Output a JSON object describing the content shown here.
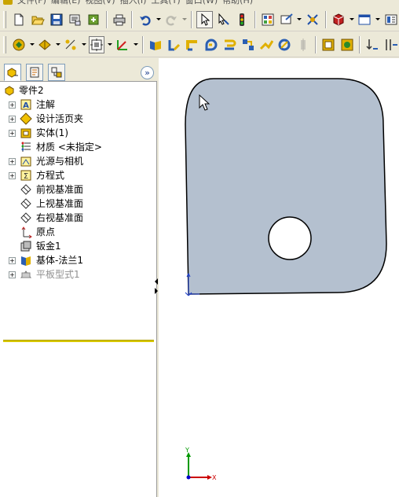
{
  "menu": {
    "items": [
      "文件(F)",
      "编辑(E)",
      "视图(V)",
      "插入(I)",
      "工具(T)",
      "窗口(W)",
      "帮助(H)"
    ]
  },
  "toolbar1": {
    "buttons": [
      "new-document",
      "open",
      "save",
      "print-preview",
      "rebuild",
      "print",
      "undo",
      "redo",
      "select",
      "smart-select",
      "traffic-light",
      "options",
      "edit-appearance",
      "cube",
      "window",
      "task-pane"
    ]
  },
  "toolbar2": {
    "buttons": [
      "view-orientation",
      "display-style",
      "hide-show",
      "section-view",
      "view-settings",
      "sheet-metal-bend",
      "base-flange",
      "edge-flange",
      "miter-flange",
      "hem",
      "jog",
      "sketched-bend",
      "cross-break",
      "flatten",
      "unfold",
      "fold",
      "insert-bends"
    ]
  },
  "feature_tree": {
    "tabs": [
      "featuremanager-tab",
      "propertymanager-tab",
      "configurationmanager-tab"
    ],
    "collapse_label": "»",
    "root": "零件2",
    "items": [
      {
        "label": "注解",
        "icon": "annotations-icon",
        "expandable": true
      },
      {
        "label": "设计活页夹",
        "icon": "design-binder-icon",
        "expandable": true
      },
      {
        "label": "实体(1)",
        "icon": "solid-bodies-icon",
        "expandable": true
      },
      {
        "label": "材质 <未指定>",
        "icon": "material-icon",
        "expandable": false
      },
      {
        "label": "光源与相机",
        "icon": "lights-cameras-icon",
        "expandable": true
      },
      {
        "label": "方程式",
        "icon": "equations-icon",
        "expandable": true
      },
      {
        "label": "前视基准面",
        "icon": "plane-icon",
        "expandable": false
      },
      {
        "label": "上视基准面",
        "icon": "plane-icon",
        "expandable": false
      },
      {
        "label": "右视基准面",
        "icon": "plane-icon",
        "expandable": false
      },
      {
        "label": "原点",
        "icon": "origin-icon",
        "expandable": false
      },
      {
        "label": "钣金1",
        "icon": "sheet-metal-icon",
        "expandable": false
      },
      {
        "label": "基体-法兰1",
        "icon": "base-flange-icon",
        "expandable": true
      },
      {
        "label": "平板型式1",
        "icon": "flat-pattern-icon",
        "expandable": true,
        "suppressed": true
      }
    ]
  },
  "graphics": {
    "part_color": "#b4c0cf",
    "triad": {
      "x_label": "X",
      "y_label": "Y"
    }
  },
  "colors": {
    "toolbar_bg": "#ece9d8",
    "rollback_bar": "#d8c800",
    "triad_x": "#cc0000",
    "triad_y": "#009900",
    "triad_z": "#0000cc"
  }
}
